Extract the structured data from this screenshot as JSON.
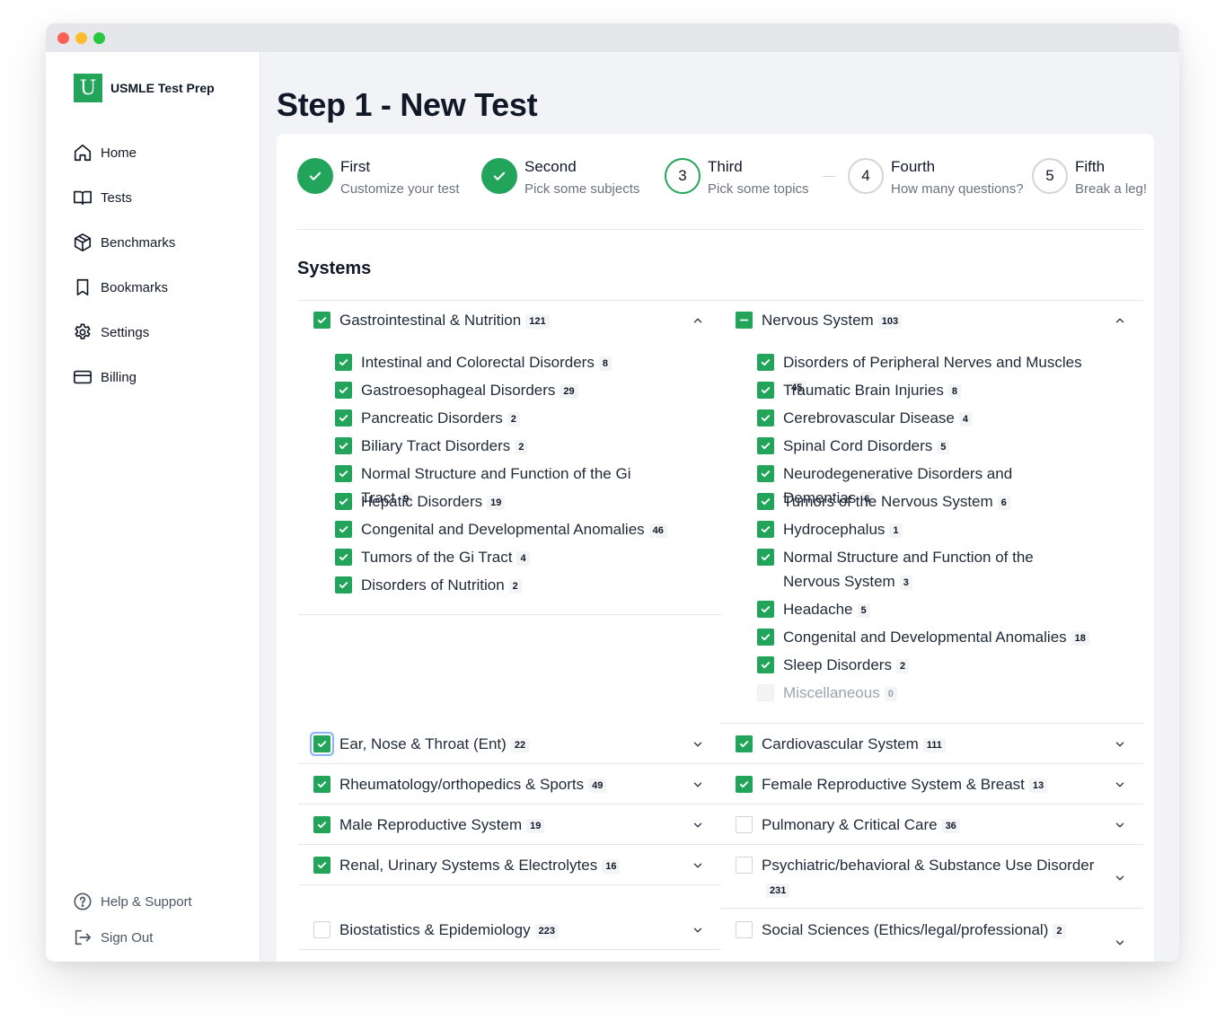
{
  "app": {
    "name": "USMLE Test Prep",
    "logo_letter": "U",
    "accent": "#22a55a"
  },
  "sidebar": {
    "items": [
      {
        "label": "Home",
        "icon": "home-icon"
      },
      {
        "label": "Tests",
        "icon": "book-icon"
      },
      {
        "label": "Benchmarks",
        "icon": "cube-icon"
      },
      {
        "label": "Bookmarks",
        "icon": "bookmark-icon"
      },
      {
        "label": "Settings",
        "icon": "gear-icon"
      },
      {
        "label": "Billing",
        "icon": "credit-card-icon"
      }
    ],
    "bottom": [
      {
        "label": "Help & Support",
        "icon": "help-circle-icon"
      },
      {
        "label": "Sign Out",
        "icon": "sign-out-icon"
      }
    ]
  },
  "page": {
    "title": "Step 1 - New Test"
  },
  "steps": [
    {
      "name": "First",
      "desc": "Customize your test",
      "state": "done"
    },
    {
      "name": "Second",
      "desc": "Pick some subjects",
      "state": "done"
    },
    {
      "number": "3",
      "name": "Third",
      "desc": "Pick some topics",
      "state": "current"
    },
    {
      "number": "4",
      "name": "Fourth",
      "desc": "How many questions?",
      "state": "todo"
    },
    {
      "number": "5",
      "name": "Fifth",
      "desc": "Break a leg!",
      "state": "todo"
    }
  ],
  "section": {
    "title": "Systems"
  },
  "systems": [
    {
      "label": "Gastrointestinal & Nutrition",
      "count": "121",
      "state": "checked",
      "expanded": true,
      "topics": [
        {
          "label": "Intestinal and Colorectal Disorders",
          "count": "8",
          "state": "checked"
        },
        {
          "label": "Gastroesophageal Disorders",
          "count": "29",
          "state": "checked"
        },
        {
          "label": "Pancreatic Disorders",
          "count": "2",
          "state": "checked"
        },
        {
          "label": "Biliary Tract Disorders",
          "count": "2",
          "state": "checked"
        },
        {
          "label": "Normal Structure and Function of the Gi Tract",
          "count": "9",
          "state": "checked"
        },
        {
          "label": "Hepatic Disorders",
          "count": "19",
          "state": "checked"
        },
        {
          "label": "Congenital and Developmental Anomalies",
          "count": "46",
          "state": "checked"
        },
        {
          "label": "Tumors of the Gi Tract",
          "count": "4",
          "state": "checked"
        },
        {
          "label": "Disorders of Nutrition",
          "count": "2",
          "state": "checked"
        }
      ]
    },
    {
      "label": "Nervous System",
      "count": "103",
      "state": "partial",
      "expanded": true,
      "topics": [
        {
          "label": "Disorders of Peripheral Nerves and Muscles",
          "count": "45",
          "state": "checked"
        },
        {
          "label": "Traumatic Brain Injuries",
          "count": "8",
          "state": "checked"
        },
        {
          "label": "Cerebrovascular Disease",
          "count": "4",
          "state": "checked"
        },
        {
          "label": "Spinal Cord Disorders",
          "count": "5",
          "state": "checked"
        },
        {
          "label": "Neurodegenerative Disorders and Dementias",
          "count": "6",
          "state": "checked"
        },
        {
          "label": "Tumors of the Nervous System",
          "count": "6",
          "state": "checked"
        },
        {
          "label": "Hydrocephalus",
          "count": "1",
          "state": "checked"
        },
        {
          "label": "Normal Structure and Function of the Nervous System",
          "count": "3",
          "state": "checked"
        },
        {
          "label": "Headache",
          "count": "5",
          "state": "checked"
        },
        {
          "label": "Congenital and Developmental Anomalies",
          "count": "18",
          "state": "checked"
        },
        {
          "label": "Sleep Disorders",
          "count": "2",
          "state": "checked"
        },
        {
          "label": "Miscellaneous",
          "count": "0",
          "state": "disabled"
        }
      ]
    },
    {
      "label": "Ear, Nose & Throat (Ent)",
      "count": "22",
      "state": "checked",
      "expanded": false,
      "focused": true
    },
    {
      "label": "Cardiovascular System",
      "count": "111",
      "state": "checked",
      "expanded": false
    },
    {
      "label": "Rheumatology/orthopedics & Sports",
      "count": "49",
      "state": "checked",
      "expanded": false
    },
    {
      "label": "Female Reproductive System & Breast",
      "count": "13",
      "state": "checked",
      "expanded": false
    },
    {
      "label": "Male Reproductive System",
      "count": "19",
      "state": "checked",
      "expanded": false
    },
    {
      "label": "Pulmonary & Critical Care",
      "count": "36",
      "state": "empty",
      "expanded": false
    },
    {
      "label": "Renal, Urinary Systems & Electrolytes",
      "count": "16",
      "state": "checked",
      "expanded": false
    },
    {
      "label": "Psychiatric/behavioral & Substance Use Disorder",
      "count": "231",
      "state": "empty",
      "expanded": false
    },
    {
      "label": "Biostatistics & Epidemiology",
      "count": "223",
      "state": "empty",
      "expanded": false
    },
    {
      "label": "Social Sciences (Ethics/legal/professional)",
      "count": "2",
      "state": "empty",
      "expanded": false
    }
  ]
}
